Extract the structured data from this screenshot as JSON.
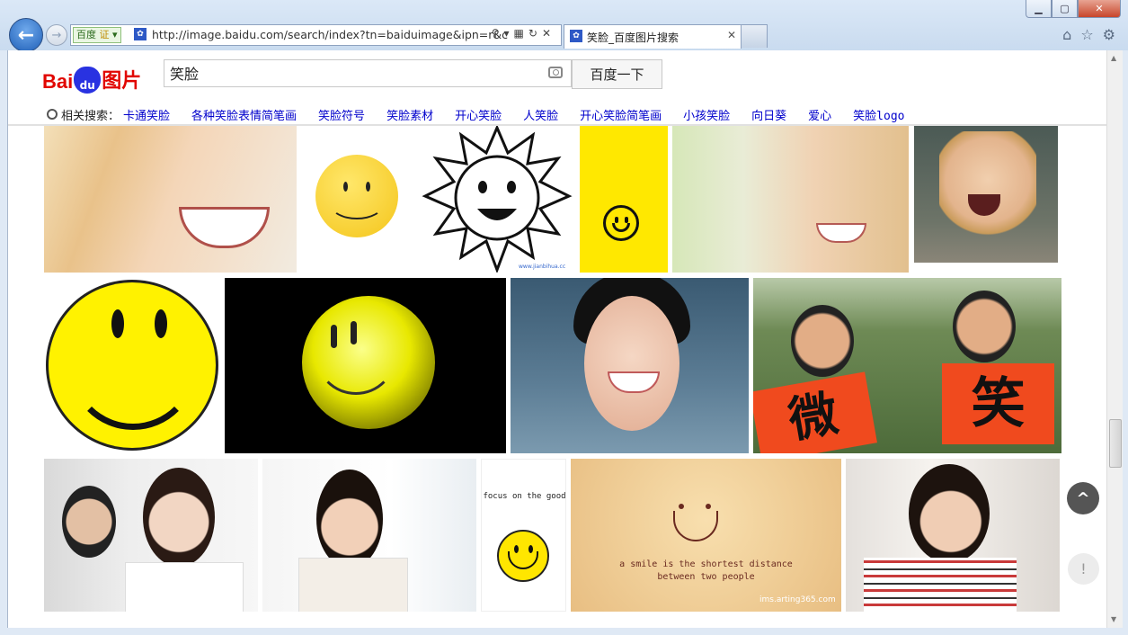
{
  "window": {
    "minimize_label": "▭",
    "maximize_label": "▢",
    "close_label": "✕"
  },
  "browser": {
    "url_badge_left": "百度",
    "url_badge_right": "证",
    "url": "http://image.baidu.com/search/index?tn=baiduimage&ipn=r&c",
    "tab_title": "笑脸_百度图片搜索"
  },
  "header": {
    "logo_text_bai": "Bai",
    "logo_text_du": "du",
    "logo_text_tu": "图片",
    "search_value": "笑脸",
    "search_button": "百度一下"
  },
  "related": {
    "label": "相关搜索：",
    "links": [
      "卡通笑脸",
      "各种笑脸表情简笔画",
      "笑脸符号",
      "笑脸素材",
      "开心笑脸",
      "人笑脸",
      "开心笑脸简笔画",
      "小孩笑脸",
      "向日葵",
      "爱心",
      "笑脸logo"
    ]
  },
  "images": {
    "row1": [
      "woman-winking",
      "yellow-smiley",
      "sun-drawing",
      "yellow-smiley-card",
      "blonde-woman",
      "laughing-child"
    ],
    "row2": [
      "big-smiley",
      "glowing-smiley",
      "smiling-woman",
      "kids-holding-signs"
    ],
    "row3": [
      "office-women",
      "woman-white-blouse",
      "focus-on-the-good",
      "smile-quote",
      "girl-striped-shirt"
    ],
    "sun_caption": "www.jianbihua.cc",
    "kids_sign_left": "微",
    "kids_sign_right": "笑",
    "focus_caption": "focus on the good",
    "quote_line1": "a smile is the shortest distance",
    "quote_line2": "between two people",
    "quote_source": "ims.arting365.com"
  },
  "floating": {
    "up_icon": "^",
    "feedback_icon": "!"
  },
  "colors": {
    "link": "#0000cc",
    "baidu_red": "#e10601",
    "baidu_blue": "#2932e1"
  }
}
